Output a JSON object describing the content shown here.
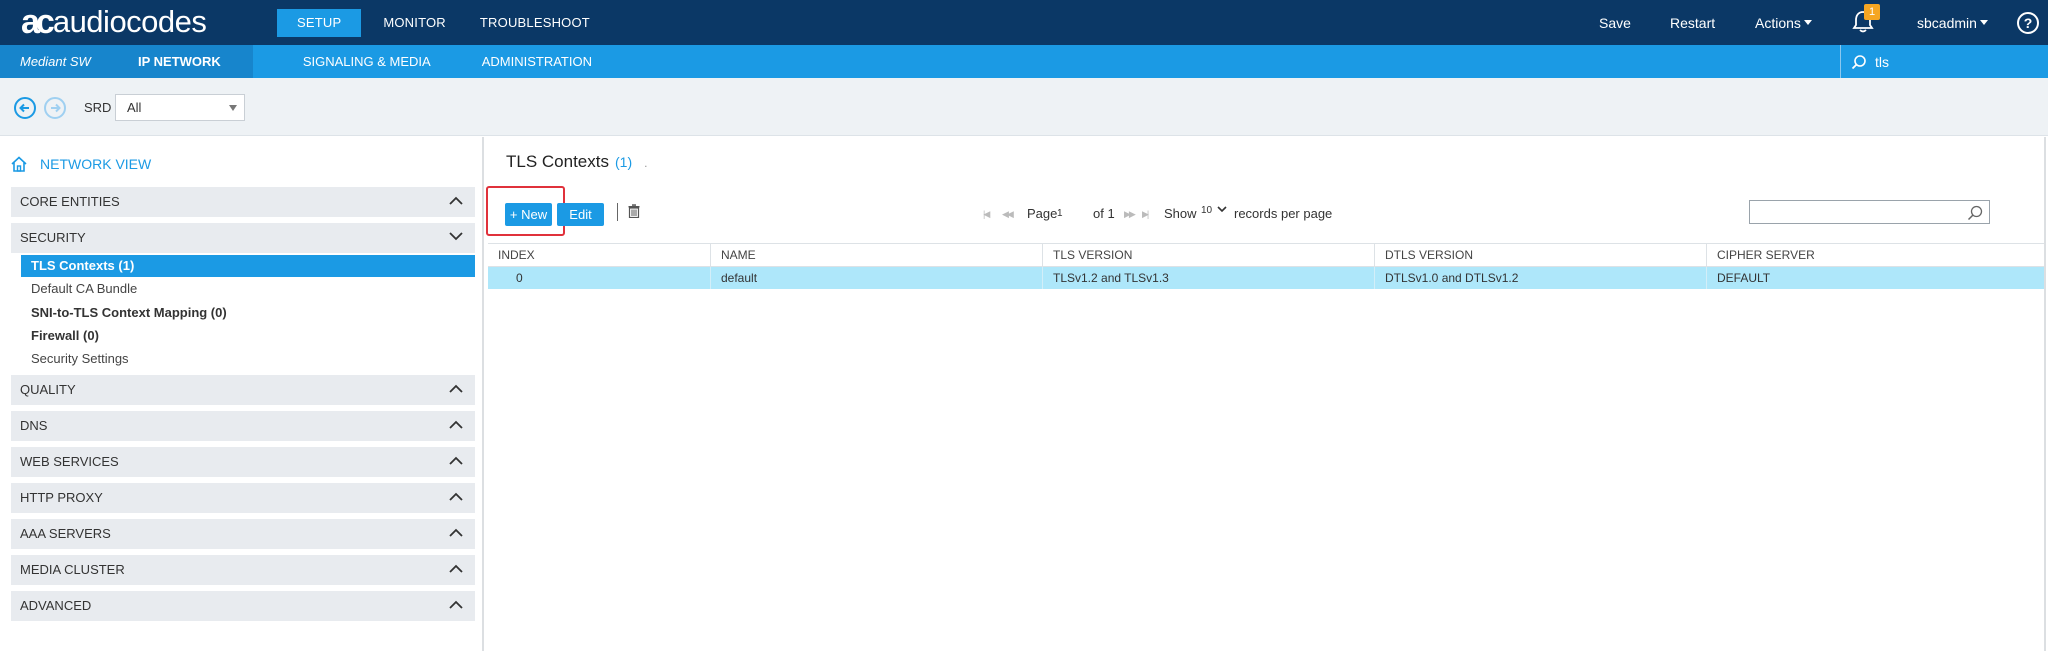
{
  "topbar": {
    "logo_mark": "ac",
    "logo_text": "audiocodes",
    "nav": [
      {
        "label": "SETUP",
        "active": true
      },
      {
        "label": "MONITOR",
        "active": false
      },
      {
        "label": "TROUBLESHOOT",
        "active": false
      }
    ],
    "save_label": "Save",
    "restart_label": "Restart",
    "actions_label": "Actions",
    "notification_count": "1",
    "user_label": "sbcadmin",
    "help_label": "?"
  },
  "subbar": {
    "product": "Mediant SW",
    "nav": [
      {
        "label": "IP NETWORK",
        "active": true
      },
      {
        "label": "SIGNALING & MEDIA",
        "active": false
      },
      {
        "label": "ADMINISTRATION",
        "active": false
      }
    ],
    "search_value": "tls"
  },
  "toolbar": {
    "srd_label": "SRD",
    "srd_value": "All"
  },
  "sidebar": {
    "network_view": "NETWORK VIEW",
    "sections": {
      "core_entities": "CORE ENTITIES",
      "security": "SECURITY",
      "quality": "QUALITY",
      "dns": "DNS",
      "web_services": "WEB SERVICES",
      "http_proxy": "HTTP PROXY",
      "aaa_servers": "AAA SERVERS",
      "media_cluster": "MEDIA CLUSTER",
      "advanced": "ADVANCED"
    },
    "security_items": {
      "tls_contexts": "TLS Contexts (1)",
      "default_ca_bundle": "Default CA Bundle",
      "sni_mapping": "SNI-to-TLS Context Mapping (0)",
      "firewall": "Firewall (0)",
      "security_settings": "Security Settings"
    }
  },
  "main": {
    "title": "TLS Contexts",
    "count": "(1)",
    "dot": ".",
    "new_label": "+ New",
    "edit_label": "Edit",
    "pager": {
      "page_label": "Page",
      "page_value": "1",
      "of_label": "of 1",
      "show_label": "Show",
      "show_value": "10",
      "records_label": "records per page"
    },
    "table": {
      "headers": {
        "index": "INDEX",
        "name": "NAME",
        "tls_version": "TLS VERSION",
        "dtls_version": "DTLS VERSION",
        "cipher_server": "CIPHER SERVER"
      },
      "rows": [
        {
          "index": "0",
          "name": "default",
          "tls_version": "TLSv1.2 and TLSv1.3",
          "dtls_version": "DTLSv1.0 and DTLSv1.2",
          "cipher_server": "DEFAULT"
        }
      ]
    }
  },
  "colors": {
    "topbar": "#0b3866",
    "accent": "#1b9ae4",
    "selected_row": "#aee7fa",
    "highlight": "#e0313b",
    "badge": "#f5a623"
  }
}
